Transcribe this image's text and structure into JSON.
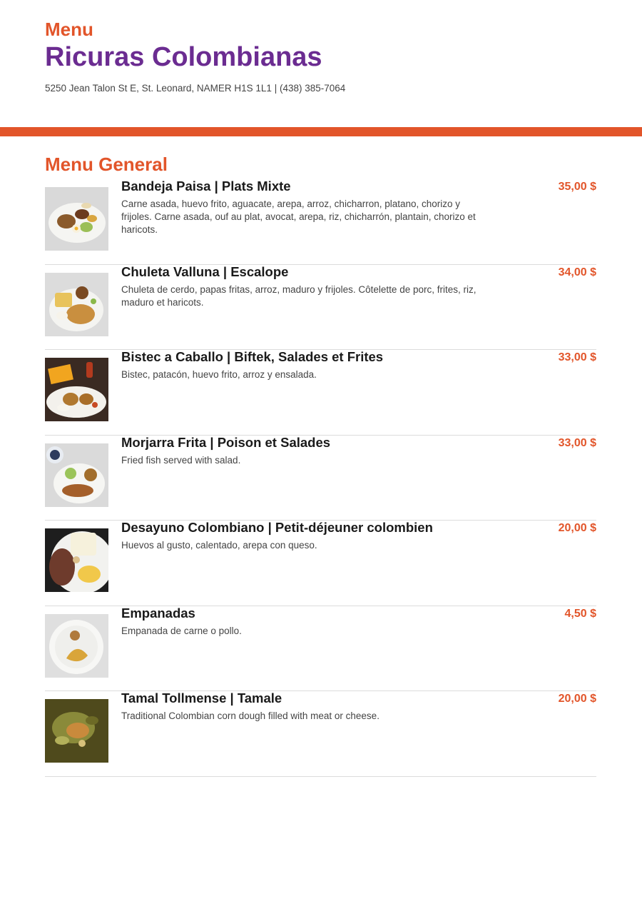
{
  "header": {
    "menu_label": "Menu",
    "restaurant_name": "Ricuras Colombianas",
    "address": "5250 Jean Talon St E, St. Leonard, NAMER H1S 1L1 | (438) 385-7064"
  },
  "section": {
    "title": "Menu General",
    "items": [
      {
        "name": "Bandeja Paisa | Plats Mixte",
        "price": "35,00 $",
        "description": "Carne asada, huevo frito, aguacate, arepa, arroz, chicharron, platano, chorizo y frijoles. Carne asada, ouf au plat, avocat, arepa, riz, chicharrón, plantain, chorizo et haricots.",
        "image_icon": "bandeja-paisa-photo"
      },
      {
        "name": "Chuleta Valluna | Escalope",
        "price": "34,00 $",
        "description": "Chuleta de cerdo, papas fritas, arroz, maduro y frijoles. Côtelette de porc, frites, riz, maduro et haricots.",
        "image_icon": "chuleta-valluna-photo"
      },
      {
        "name": "Bistec a Caballo | Biftek, Salades et Frites",
        "price": "33,00 $",
        "description": "Bistec, patacón, huevo frito, arroz y ensalada.",
        "image_icon": "bistec-a-caballo-photo"
      },
      {
        "name": "Morjarra Frita | Poison et Salades",
        "price": "33,00 $",
        "description": "Fried fish served with salad.",
        "image_icon": "morjarra-frita-photo"
      },
      {
        "name": "Desayuno Colombiano | Petit-déjeuner colombien",
        "price": "20,00 $",
        "description": "Huevos al gusto, calentado, arepa con queso.",
        "image_icon": "desayuno-colombiano-photo"
      },
      {
        "name": "Empanadas",
        "price": "4,50 $",
        "description": "Empanada de carne o pollo.",
        "image_icon": "empanadas-photo"
      },
      {
        "name": "Tamal Tollmense | Tamale",
        "price": "20,00 $",
        "description": "Traditional Colombian corn dough filled with meat or cheese.",
        "image_icon": "tamal-photo"
      }
    ]
  },
  "colors": {
    "accent": "#e2552a",
    "title_purple": "#6b2c91"
  }
}
